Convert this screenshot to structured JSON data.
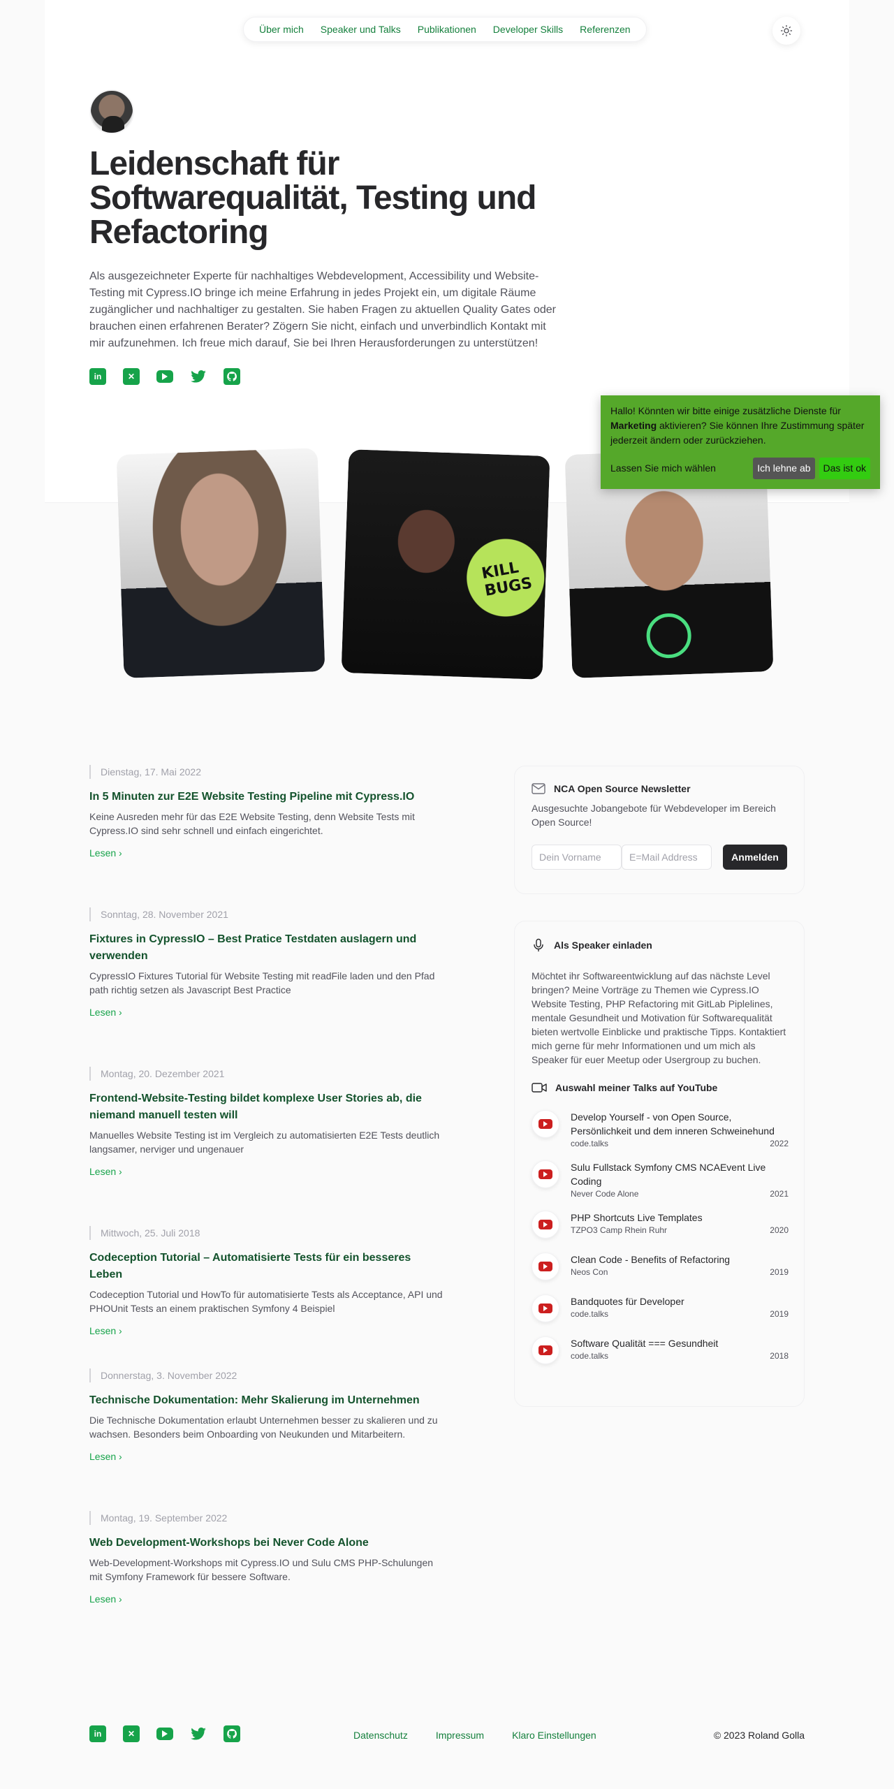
{
  "nav": {
    "items": [
      {
        "label": "Über mich"
      },
      {
        "label": "Speaker und Talks"
      },
      {
        "label": "Publikationen"
      },
      {
        "label": "Developer Skills"
      },
      {
        "label": "Referenzen"
      }
    ]
  },
  "hero": {
    "title": "Leidenschaft für Softwarequalität, Testing und Refactoring",
    "intro": "Als ausgezeichneter Experte für nachhaltiges Webdevelopment, Accessibility und Website-Testing mit Cypress.IO bringe ich meine Erfahrung in jedes Projekt ein, um digitale Räume zugänglicher und nachhaltiger zu gestalten. Sie haben Fragen zu aktuellen Quality Gates oder brauchen einen erfahrenen Berater? Zögern Sie nicht, einfach und unverbindlich Kontakt mit mir aufzunehmen. Ich freue mich darauf, Sie bei Ihren Herausforderungen zu unterstützen!"
  },
  "photos": {
    "laptop_sticker": "KILL BUGS"
  },
  "cookie": {
    "text_before": "Hallo! Könnten wir bitte einige zusätzliche Dienste für ",
    "text_bold": "Marketing",
    "text_after": " aktivieren? Sie können Ihre Zustimmung später jederzeit ändern oder zurückziehen.",
    "learn_more": "Lassen Sie mich wählen",
    "decline": "Ich lehne ab",
    "accept": "Das ist ok",
    "bg_color": "#55a82a"
  },
  "articles": [
    {
      "date": "Dienstag, 17. Mai 2022",
      "title": "In 5 Minuten zur E2E Website Testing Pipeline mit Cypress.IO",
      "desc": "Keine Ausreden mehr für das E2E Website Testing, denn Website Tests mit Cypress.IO sind sehr schnell und einfach eingerichtet.",
      "read": "Lesen"
    },
    {
      "date": "Sonntag, 28. November 2021",
      "title": "Fixtures in CypressIO – Best Pratice Testdaten auslagern und verwenden",
      "desc": "CypressIO Fixtures Tutorial für Website Testing mit readFile laden und den Pfad path richtig setzen als Javascript Best Practice",
      "read": "Lesen"
    },
    {
      "date": "Montag, 20. Dezember 2021",
      "title": "Frontend-Website-Testing bildet komplexe User Stories ab, die niemand manuell testen will",
      "desc": "Manuelles Website Testing ist im Vergleich zu automatisierten E2E Tests deutlich langsamer, nerviger und ungenauer",
      "read": "Lesen"
    },
    {
      "date": "Mittwoch, 25. Juli 2018",
      "title": "Codeception Tutorial – Automatisierte Tests für ein besseres Leben",
      "desc": "Codeception Tutorial und HowTo für automatisierte Tests als Acceptance, API und PHOUnit Tests an einem praktischen Symfony 4 Beispiel",
      "read": "Lesen"
    },
    {
      "date": "Donnerstag, 3. November 2022",
      "title": "Technische Dokumentation: Mehr Skalierung im Unternehmen",
      "desc": "Die Technische Dokumentation erlaubt Unternehmen besser zu skalieren und zu wachsen. Besonders beim Onboarding von Neukunden und Mitarbeitern.",
      "read": "Lesen"
    },
    {
      "date": "Montag, 19. September 2022",
      "title": "Web Development-Workshops bei Never Code Alone",
      "desc": "Web-Development-Workshops mit Cypress.IO und Sulu CMS PHP-Schulungen mit Symfony Framework für bessere Software.",
      "read": "Lesen"
    }
  ],
  "newsletter": {
    "title": "NCA Open Source Newsletter",
    "text": "Ausgesuchte Jobangebote für Webdeveloper im Bereich Open Source!",
    "firstname_placeholder": "Dein Vorname",
    "email_placeholder": "E=Mail Address",
    "button": "Anmelden"
  },
  "speaker": {
    "title": "Als Speaker einladen",
    "text": "Möchtet ihr Softwareentwicklung auf das nächste Level bringen? Meine Vorträge zu Themen wie Cypress.IO Website Testing, PHP Refactoring mit GitLab Piplelines, mentale Gesundheit und Motivation für Softwarequalität bieten wertvolle Einblicke und praktische Tipps. Kontaktiert mich gerne für mehr Informationen und um mich als Speaker für euer Meetup oder Usergroup zu buchen.",
    "talks_title": "Auswahl meiner Talks auf YouTube",
    "talks": [
      {
        "title": "Develop Yourself - von Open Source, Persönlichkeit und dem inneren Schweinehund",
        "event": "code.talks",
        "year": "2022"
      },
      {
        "title": "Sulu Fullstack Symfony CMS NCAEvent Live Coding",
        "event": "Never Code Alone",
        "year": "2021"
      },
      {
        "title": "PHP Shortcuts Live Templates",
        "event": "TZPO3 Camp Rhein Ruhr",
        "year": "2020"
      },
      {
        "title": "Clean Code - Benefits of Refactoring",
        "event": "Neos Con",
        "year": "2019"
      },
      {
        "title": "Bandquotes für Developer",
        "event": "code.talks",
        "year": "2019"
      },
      {
        "title": "Software Qualität === Gesundheit",
        "event": "code.talks",
        "year": "2018"
      }
    ]
  },
  "footer": {
    "links": [
      {
        "label": "Datenschutz"
      },
      {
        "label": "Impressum"
      },
      {
        "label": "Klaro Einstellungen"
      }
    ],
    "copyright": "© 2023 Roland Golla"
  },
  "colors": {
    "accent": "#16a34a",
    "link": "#15803d",
    "title_green": "#14532d",
    "youtube_red": "#cc1f1f"
  },
  "icons": [
    "linkedin-icon",
    "xing-icon",
    "youtube-icon",
    "twitter-icon",
    "github-icon",
    "sun-icon",
    "mail-icon",
    "microphone-icon",
    "video-icon"
  ]
}
